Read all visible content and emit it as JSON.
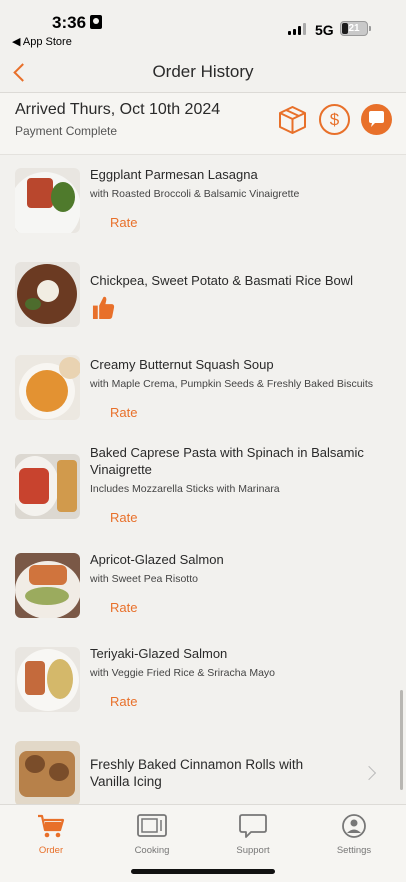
{
  "status_bar": {
    "time": "3:36",
    "back_app": "◀ App Store",
    "network": "5G",
    "battery": "21"
  },
  "nav": {
    "title": "Order History"
  },
  "order": {
    "arrived": "Arrived Thurs, Oct 10th 2024",
    "payment_status": "Payment Complete"
  },
  "items": [
    {
      "title": "Eggplant Parmesan Lasagna",
      "subtitle": "with Roasted Broccoli & Balsamic Vinaigrette",
      "action": "Rate"
    },
    {
      "title": "Chickpea, Sweet Potato & Basmati Rice Bowl",
      "subtitle": "",
      "action": "thumbs-up-icon"
    },
    {
      "title": "Creamy Butternut Squash Soup",
      "subtitle": "with Maple Crema, Pumpkin Seeds & Freshly Baked Biscuits",
      "action": "Rate"
    },
    {
      "title": "Baked Caprese Pasta with Spinach in Balsamic Vinaigrette",
      "subtitle": "Includes Mozzarella Sticks with Marinara",
      "action": "Rate"
    },
    {
      "title": "Apricot-Glazed Salmon",
      "subtitle": "with Sweet Pea Risotto",
      "action": "Rate"
    },
    {
      "title": "Teriyaki-Glazed Salmon",
      "subtitle": "with Veggie Fried Rice & Sriracha Mayo",
      "action": "Rate"
    },
    {
      "title": "Freshly Baked Cinnamon Rolls with Vanilla Icing",
      "subtitle": "",
      "action": "chevron-right-icon"
    }
  ],
  "tabs": [
    {
      "label": "Order",
      "icon": "cart-icon",
      "active": true
    },
    {
      "label": "Cooking",
      "icon": "oven-icon",
      "active": false
    },
    {
      "label": "Support",
      "icon": "chat-bubble-icon",
      "active": false
    },
    {
      "label": "Settings",
      "icon": "person-circle-icon",
      "active": false
    }
  ],
  "colors": {
    "accent": "#e8702a",
    "background": "#f2f1ee",
    "text": "#2a2a2a"
  }
}
